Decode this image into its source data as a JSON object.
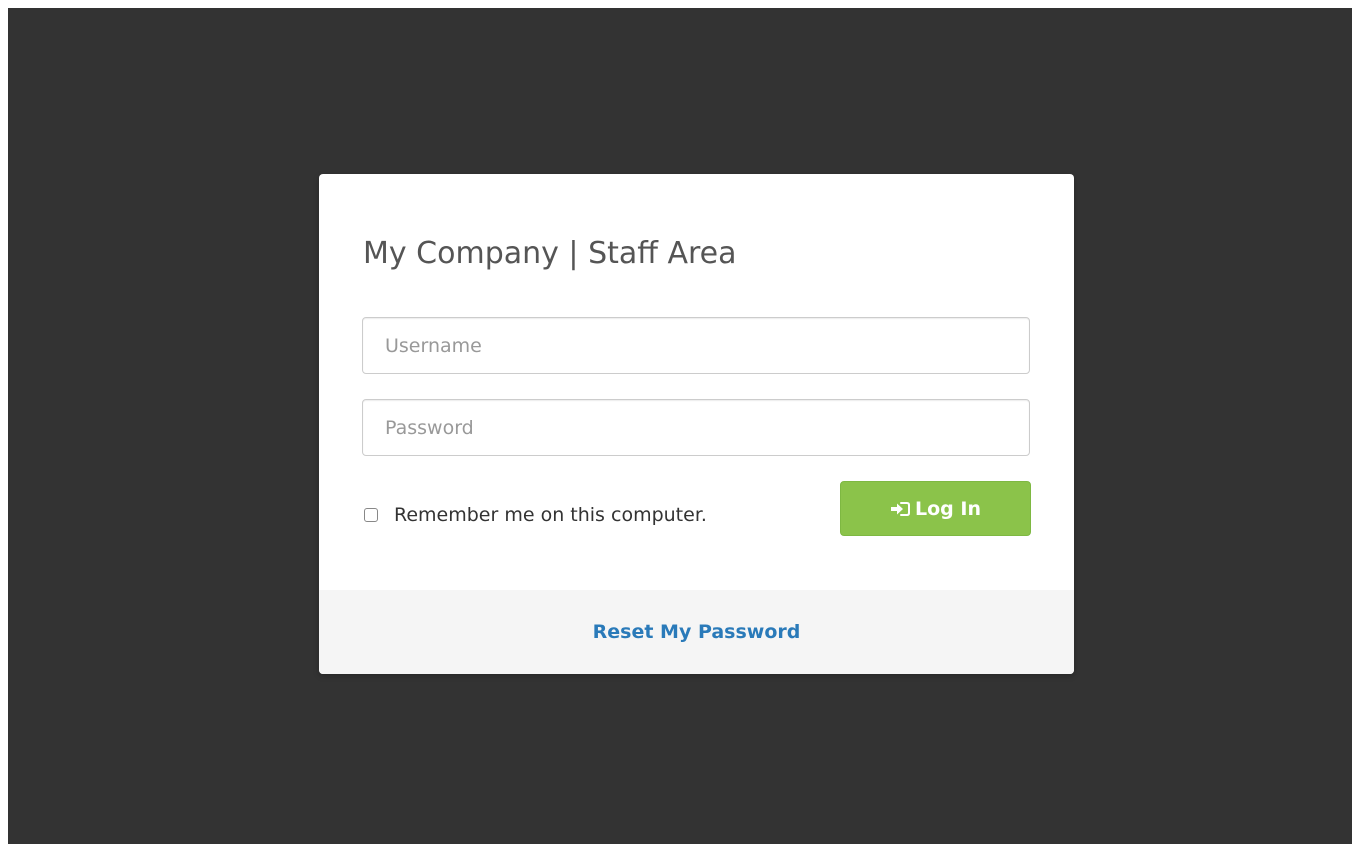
{
  "form": {
    "title": "My Company | Staff Area",
    "username_placeholder": "Username",
    "password_placeholder": "Password",
    "remember_label": "Remember me on this computer.",
    "remember_checked": false,
    "login_label": "Log In",
    "login_icon": "sign-in-icon",
    "reset_label": "Reset My Password"
  },
  "colors": {
    "backdrop": "#333333",
    "card": "#ffffff",
    "footer": "#f5f5f5",
    "login_button": "#8bc34a",
    "link": "#2a7ab9"
  }
}
